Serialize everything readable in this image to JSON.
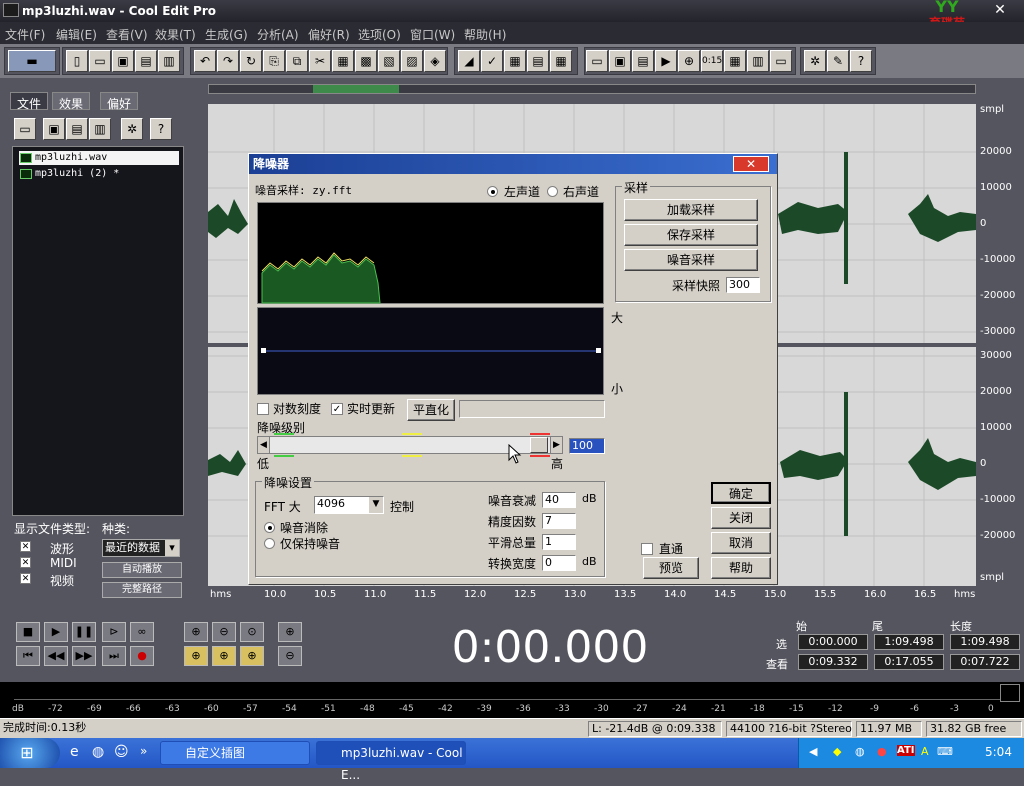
{
  "window": {
    "title": "mp3luzhi.wav - Cool Edit Pro",
    "logo_text": "育碟苑",
    "logo_mark": "YY"
  },
  "menu": [
    "文件(F)",
    "编辑(E)",
    "查看(V)",
    "效果(T)",
    "生成(G)",
    "分析(A)",
    "偏好(R)",
    "选项(O)",
    "窗口(W)",
    "帮助(H)"
  ],
  "left_panel": {
    "tabs": [
      "文件",
      "效果",
      "偏好"
    ],
    "files": [
      "mp3luzhi.wav",
      "mp3luzhi (2) *"
    ],
    "show_types_label": "显示文件类型:",
    "kind_label": "种类:",
    "types": [
      "波形",
      "MIDI",
      "视频"
    ],
    "kind_value": "最近的数据",
    "auto_play": "自动播放",
    "full_path": "完整路径"
  },
  "waveform": {
    "right_labels_top": [
      "smpl",
      "20000",
      "10000",
      "0",
      "-10000",
      "-20000",
      "-30000"
    ],
    "right_labels_bottom": [
      "30000",
      "20000",
      "10000",
      "0",
      "-10000",
      "-20000",
      "smpl"
    ],
    "timeline": [
      "hms",
      "10.0",
      "10.5",
      "11.0",
      "11.5",
      "12.0",
      "12.5",
      "13.0",
      "13.5",
      "14.0",
      "14.5",
      "15.0",
      "15.5",
      "16.0",
      "16.5",
      "hms"
    ]
  },
  "transport": {
    "time": "0:00.000",
    "headers": [
      "始",
      "尾",
      "长度"
    ],
    "row1_label": "选",
    "row1": [
      "0:00.000",
      "1:09.498",
      "1:09.498"
    ],
    "row2_label": "查看",
    "row2": [
      "0:09.332",
      "0:17.055",
      "0:07.722"
    ]
  },
  "level_scale": [
    "dB",
    "-72",
    "-69",
    "-66",
    "-63",
    "-60",
    "-57",
    "-54",
    "-51",
    "-48",
    "-45",
    "-42",
    "-39",
    "-36",
    "-33",
    "-30",
    "-27",
    "-24",
    "-21",
    "-18",
    "-15",
    "-12",
    "-9",
    "-6",
    "-3",
    "0"
  ],
  "status": {
    "done": "完成时间:0.13秒",
    "level": "L: -21.4dB @  0:09.338",
    "format": "44100 ?16-bit ?Stereo",
    "size": "11.97 MB",
    "free": "31.82 GB free"
  },
  "taskbar": {
    "task1": "自定义插图",
    "task2": "mp3luzhi.wav - Cool E...",
    "clock": "5:04"
  },
  "dialog": {
    "title": "降噪器",
    "sample_label": "噪音采样: zy.fft",
    "left_channel": "左声道",
    "right_channel": "右声道",
    "big": "大",
    "small": "小",
    "log_scale": "对数刻度",
    "realtime": "实时更新",
    "flatten": "平直化",
    "level_label": "降噪级别",
    "low": "低",
    "high": "高",
    "level_value": "100",
    "settings_group": "降噪设置",
    "fft_label": "FFT 大",
    "fft_value": "4096",
    "control": "控制",
    "remove_noise": "噪音消除",
    "keep_noise": "仅保持噪音",
    "attenuation_label": "噪音衰减",
    "attenuation_value": "40",
    "precision_label": "精度因数",
    "precision_value": "7",
    "smoothing_label": "平滑总量",
    "smoothing_value": "1",
    "transition_label": "转换宽度",
    "transition_value": "0",
    "db": "dB",
    "sample_group": "采样",
    "load_sample": "加载采样",
    "save_sample": "保存采样",
    "noise_sample": "噪音采样",
    "snapshots_label": "采样快照",
    "snapshots_value": "300",
    "bypass": "直通",
    "preview": "预览",
    "ok": "确定",
    "close": "关闭",
    "cancel": "取消",
    "help": "帮助"
  }
}
